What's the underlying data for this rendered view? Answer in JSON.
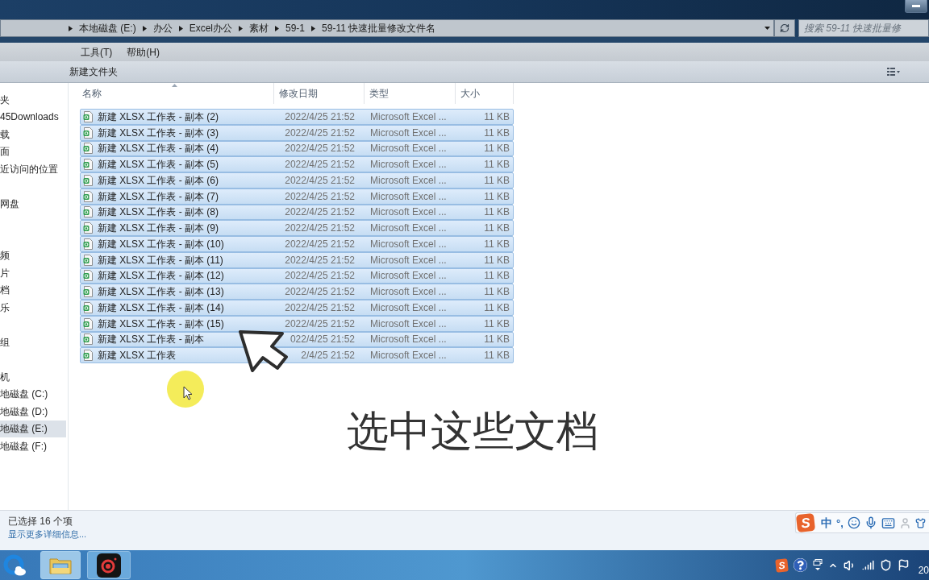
{
  "address_bar": {
    "crumbs": [
      "本地磁盘 (E:)",
      "办公",
      "Excel办公",
      "素材",
      "59-1",
      "59-11 快速批量修改文件名"
    ]
  },
  "search": {
    "placeholder": "搜索 59-11 快速批量修"
  },
  "menu": [
    "工具(T)",
    "帮助(H)"
  ],
  "toolbar": {
    "buttons": [
      "新建文件夹"
    ]
  },
  "nav": [
    {
      "label": "夹",
      "selected": false,
      "children": [
        {
          "label": "45Downloads",
          "selected": false
        },
        {
          "label": "载",
          "selected": false
        },
        {
          "label": "面",
          "selected": false
        },
        {
          "label": "近访问的位置",
          "selected": false
        }
      ]
    },
    {
      "label": "网盘",
      "selected": false
    },
    {
      "children": [
        {
          "label": "频",
          "selected": false
        },
        {
          "label": "片",
          "selected": false
        },
        {
          "label": "档",
          "selected": false
        },
        {
          "label": "乐",
          "selected": false
        }
      ]
    },
    {
      "label": "组",
      "selected": false
    },
    {
      "label": "机",
      "selected": false,
      "children": [
        {
          "label": "地磁盘 (C:)",
          "selected": false
        },
        {
          "label": "地磁盘 (D:)",
          "selected": false
        },
        {
          "label": "地磁盘 (E:)",
          "selected": true
        },
        {
          "label": "地磁盘 (F:)",
          "selected": false
        }
      ]
    }
  ],
  "file_list": {
    "columns": [
      "名称",
      "修改日期",
      "类型",
      "大小"
    ],
    "rows": [
      {
        "name": "新建 XLSX 工作表 - 副本 (2)",
        "modified": "2022/4/25 21:52",
        "type": "Microsoft Excel ...",
        "size": "11 KB",
        "selected": true
      },
      {
        "name": "新建 XLSX 工作表 - 副本 (3)",
        "modified": "2022/4/25 21:52",
        "type": "Microsoft Excel ...",
        "size": "11 KB",
        "selected": true
      },
      {
        "name": "新建 XLSX 工作表 - 副本 (4)",
        "modified": "2022/4/25 21:52",
        "type": "Microsoft Excel ...",
        "size": "11 KB",
        "selected": true
      },
      {
        "name": "新建 XLSX 工作表 - 副本 (5)",
        "modified": "2022/4/25 21:52",
        "type": "Microsoft Excel ...",
        "size": "11 KB",
        "selected": true
      },
      {
        "name": "新建 XLSX 工作表 - 副本 (6)",
        "modified": "2022/4/25 21:52",
        "type": "Microsoft Excel ...",
        "size": "11 KB",
        "selected": true
      },
      {
        "name": "新建 XLSX 工作表 - 副本 (7)",
        "modified": "2022/4/25 21:52",
        "type": "Microsoft Excel ...",
        "size": "11 KB",
        "selected": true
      },
      {
        "name": "新建 XLSX 工作表 - 副本 (8)",
        "modified": "2022/4/25 21:52",
        "type": "Microsoft Excel ...",
        "size": "11 KB",
        "selected": true
      },
      {
        "name": "新建 XLSX 工作表 - 副本 (9)",
        "modified": "2022/4/25 21:52",
        "type": "Microsoft Excel ...",
        "size": "11 KB",
        "selected": true
      },
      {
        "name": "新建 XLSX 工作表 - 副本 (10)",
        "modified": "2022/4/25 21:52",
        "type": "Microsoft Excel ...",
        "size": "11 KB",
        "selected": true
      },
      {
        "name": "新建 XLSX 工作表 - 副本 (11)",
        "modified": "2022/4/25 21:52",
        "type": "Microsoft Excel ...",
        "size": "11 KB",
        "selected": true
      },
      {
        "name": "新建 XLSX 工作表 - 副本 (12)",
        "modified": "2022/4/25 21:52",
        "type": "Microsoft Excel ...",
        "size": "11 KB",
        "selected": true
      },
      {
        "name": "新建 XLSX 工作表 - 副本 (13)",
        "modified": "2022/4/25 21:52",
        "type": "Microsoft Excel ...",
        "size": "11 KB",
        "selected": true
      },
      {
        "name": "新建 XLSX 工作表 - 副本 (14)",
        "modified": "2022/4/25 21:52",
        "type": "Microsoft Excel ...",
        "size": "11 KB",
        "selected": true
      },
      {
        "name": "新建 XLSX 工作表 - 副本 (15)",
        "modified": "2022/4/25 21:52",
        "type": "Microsoft Excel ...",
        "size": "11 KB",
        "selected": true
      },
      {
        "name": "新建 XLSX 工作表 - 副本",
        "modified": "022/4/25 21:52",
        "type": "Microsoft Excel ...",
        "size": "11 KB",
        "selected": true
      },
      {
        "name": "新建 XLSX 工作表",
        "modified": "2/4/25 21:52",
        "type": "Microsoft Excel ...",
        "size": "11 KB",
        "selected": true
      }
    ]
  },
  "caption": "选中这些文档",
  "details_pane": {
    "summary": "已选择 16 个项",
    "link": "显示更多详细信息..."
  },
  "ime_bar": {
    "logo": "S",
    "mode": "中",
    "punctuation": "°,"
  },
  "taskbar": {
    "tray_logo": "S",
    "clock": "20"
  }
}
